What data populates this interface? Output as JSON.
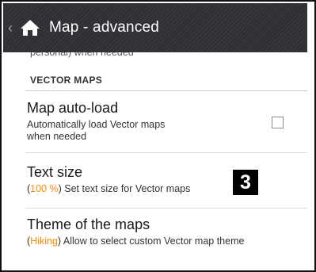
{
  "header": {
    "back_glyph": "‹",
    "title": "Map - advanced",
    "icon": "home-icon",
    "background": "#2e3034"
  },
  "prev_item_summary_cut": "personal) when needed",
  "section": {
    "header": "VECTOR MAPS"
  },
  "prefs": [
    {
      "title": "Map auto-load",
      "summary": "Automatically load Vector maps when needed",
      "checked": false
    },
    {
      "title": "Text size",
      "value": "100 %",
      "summary_suffix": "Set text size for Vector maps"
    },
    {
      "title": "Theme of the maps",
      "value": "Hiking",
      "summary_suffix": "Allow to select custom Vector map theme"
    }
  ],
  "callout": {
    "label": "3"
  },
  "colors": {
    "accent": "#ff8a00",
    "text": "#1a1a1a"
  }
}
